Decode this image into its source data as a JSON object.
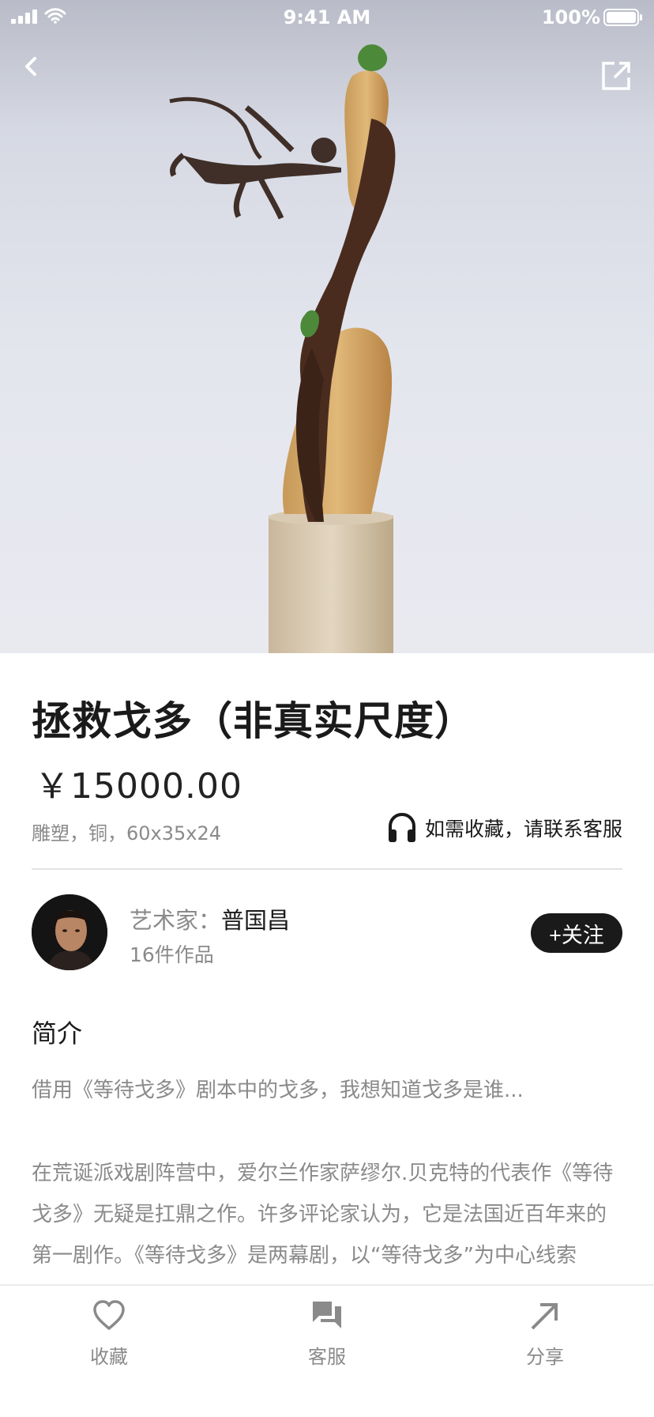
{
  "status_bar": {
    "time": "9:41 AM",
    "battery_pct": "100%"
  },
  "nav": {
    "back_icon": "chevron-left-icon",
    "share_icon": "external-link-icon"
  },
  "product": {
    "title": "拯救戈多（非真实尺度）",
    "price": "￥15000.00",
    "meta": "雕塑，铜，60x35x24",
    "contact_text": "如需收藏，请联系客服"
  },
  "artist": {
    "label": "艺术家：",
    "name": "普国昌",
    "works": "16件作品",
    "follow_label": "+关注"
  },
  "intro": {
    "heading": "简介",
    "first_line": "借用《等待戈多》剧本中的戈多，我想知道戈多是谁...",
    "body": "在荒诞派戏剧阵营中，爱尔兰作家萨缪尔.贝克特的代表作《等待戈多》无疑是扛鼎之作。许多评论家认为，它是法国近百年来的第一剧作。《等待戈多》是两幕剧，以“等待戈多”为中心线索"
  },
  "tabbar": [
    {
      "label": "收藏",
      "icon": "heart-icon"
    },
    {
      "label": "客服",
      "icon": "chat-icon"
    },
    {
      "label": "分享",
      "icon": "arrow-up-right-icon"
    }
  ],
  "colors": {
    "text": "#1a1a1a",
    "muted": "#8a8a8a",
    "button": "#1a1a1a"
  }
}
